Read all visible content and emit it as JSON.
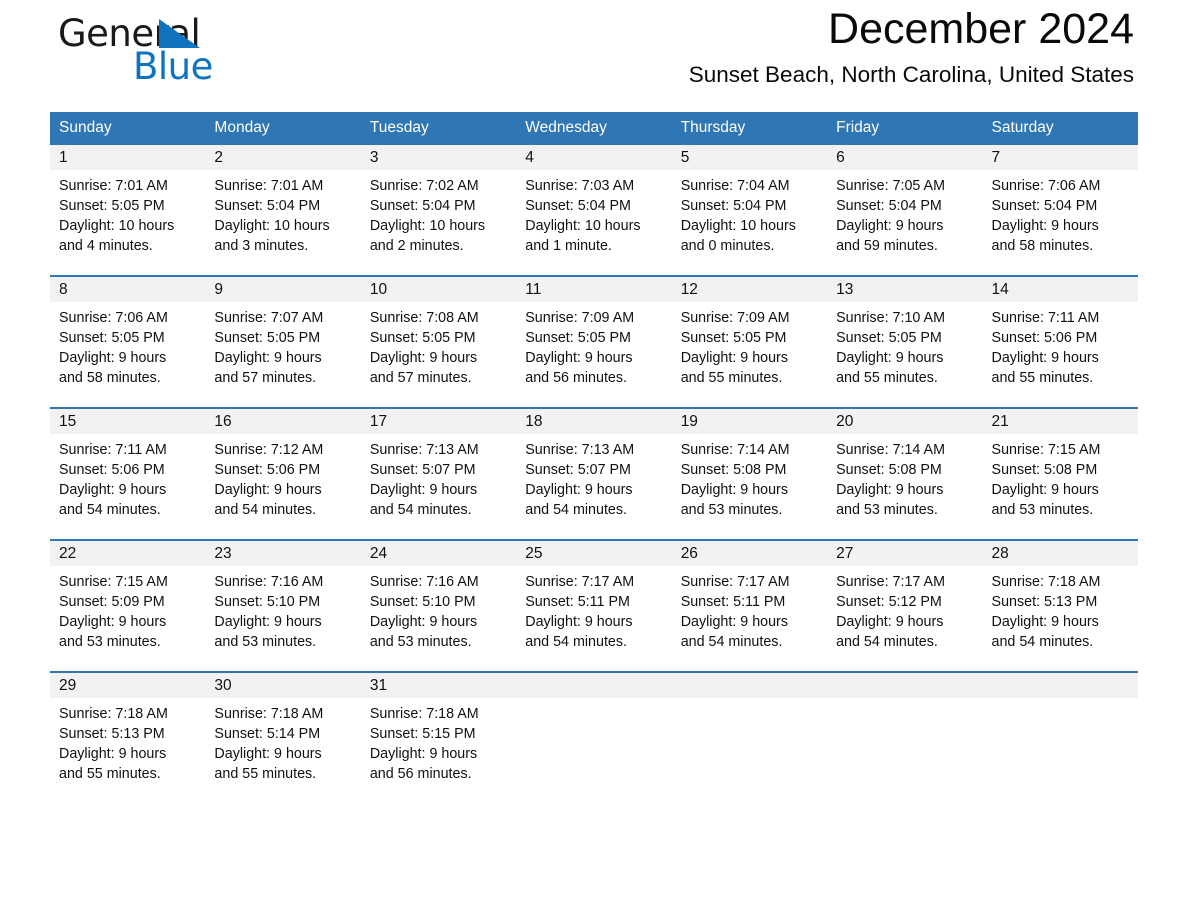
{
  "brand": {
    "name_part1": "General",
    "name_part2": "Blue",
    "triangle_color": "#0f73bd"
  },
  "header": {
    "title": "December 2024",
    "subtitle": "Sunset Beach, North Carolina, United States"
  },
  "colors": {
    "header_blue": "#2f76b4",
    "day_band_gray": "#f2f2f2",
    "text": "#111111"
  },
  "weekdays": [
    "Sunday",
    "Monday",
    "Tuesday",
    "Wednesday",
    "Thursday",
    "Friday",
    "Saturday"
  ],
  "weeks": [
    {
      "days": [
        {
          "num": "1",
          "sunrise": "Sunrise: 7:01 AM",
          "sunset": "Sunset: 5:05 PM",
          "daylight1": "Daylight: 10 hours",
          "daylight2": "and 4 minutes."
        },
        {
          "num": "2",
          "sunrise": "Sunrise: 7:01 AM",
          "sunset": "Sunset: 5:04 PM",
          "daylight1": "Daylight: 10 hours",
          "daylight2": "and 3 minutes."
        },
        {
          "num": "3",
          "sunrise": "Sunrise: 7:02 AM",
          "sunset": "Sunset: 5:04 PM",
          "daylight1": "Daylight: 10 hours",
          "daylight2": "and 2 minutes."
        },
        {
          "num": "4",
          "sunrise": "Sunrise: 7:03 AM",
          "sunset": "Sunset: 5:04 PM",
          "daylight1": "Daylight: 10 hours",
          "daylight2": "and 1 minute."
        },
        {
          "num": "5",
          "sunrise": "Sunrise: 7:04 AM",
          "sunset": "Sunset: 5:04 PM",
          "daylight1": "Daylight: 10 hours",
          "daylight2": "and 0 minutes."
        },
        {
          "num": "6",
          "sunrise": "Sunrise: 7:05 AM",
          "sunset": "Sunset: 5:04 PM",
          "daylight1": "Daylight: 9 hours",
          "daylight2": "and 59 minutes."
        },
        {
          "num": "7",
          "sunrise": "Sunrise: 7:06 AM",
          "sunset": "Sunset: 5:04 PM",
          "daylight1": "Daylight: 9 hours",
          "daylight2": "and 58 minutes."
        }
      ]
    },
    {
      "days": [
        {
          "num": "8",
          "sunrise": "Sunrise: 7:06 AM",
          "sunset": "Sunset: 5:05 PM",
          "daylight1": "Daylight: 9 hours",
          "daylight2": "and 58 minutes."
        },
        {
          "num": "9",
          "sunrise": "Sunrise: 7:07 AM",
          "sunset": "Sunset: 5:05 PM",
          "daylight1": "Daylight: 9 hours",
          "daylight2": "and 57 minutes."
        },
        {
          "num": "10",
          "sunrise": "Sunrise: 7:08 AM",
          "sunset": "Sunset: 5:05 PM",
          "daylight1": "Daylight: 9 hours",
          "daylight2": "and 57 minutes."
        },
        {
          "num": "11",
          "sunrise": "Sunrise: 7:09 AM",
          "sunset": "Sunset: 5:05 PM",
          "daylight1": "Daylight: 9 hours",
          "daylight2": "and 56 minutes."
        },
        {
          "num": "12",
          "sunrise": "Sunrise: 7:09 AM",
          "sunset": "Sunset: 5:05 PM",
          "daylight1": "Daylight: 9 hours",
          "daylight2": "and 55 minutes."
        },
        {
          "num": "13",
          "sunrise": "Sunrise: 7:10 AM",
          "sunset": "Sunset: 5:05 PM",
          "daylight1": "Daylight: 9 hours",
          "daylight2": "and 55 minutes."
        },
        {
          "num": "14",
          "sunrise": "Sunrise: 7:11 AM",
          "sunset": "Sunset: 5:06 PM",
          "daylight1": "Daylight: 9 hours",
          "daylight2": "and 55 minutes."
        }
      ]
    },
    {
      "days": [
        {
          "num": "15",
          "sunrise": "Sunrise: 7:11 AM",
          "sunset": "Sunset: 5:06 PM",
          "daylight1": "Daylight: 9 hours",
          "daylight2": "and 54 minutes."
        },
        {
          "num": "16",
          "sunrise": "Sunrise: 7:12 AM",
          "sunset": "Sunset: 5:06 PM",
          "daylight1": "Daylight: 9 hours",
          "daylight2": "and 54 minutes."
        },
        {
          "num": "17",
          "sunrise": "Sunrise: 7:13 AM",
          "sunset": "Sunset: 5:07 PM",
          "daylight1": "Daylight: 9 hours",
          "daylight2": "and 54 minutes."
        },
        {
          "num": "18",
          "sunrise": "Sunrise: 7:13 AM",
          "sunset": "Sunset: 5:07 PM",
          "daylight1": "Daylight: 9 hours",
          "daylight2": "and 54 minutes."
        },
        {
          "num": "19",
          "sunrise": "Sunrise: 7:14 AM",
          "sunset": "Sunset: 5:08 PM",
          "daylight1": "Daylight: 9 hours",
          "daylight2": "and 53 minutes."
        },
        {
          "num": "20",
          "sunrise": "Sunrise: 7:14 AM",
          "sunset": "Sunset: 5:08 PM",
          "daylight1": "Daylight: 9 hours",
          "daylight2": "and 53 minutes."
        },
        {
          "num": "21",
          "sunrise": "Sunrise: 7:15 AM",
          "sunset": "Sunset: 5:08 PM",
          "daylight1": "Daylight: 9 hours",
          "daylight2": "and 53 minutes."
        }
      ]
    },
    {
      "days": [
        {
          "num": "22",
          "sunrise": "Sunrise: 7:15 AM",
          "sunset": "Sunset: 5:09 PM",
          "daylight1": "Daylight: 9 hours",
          "daylight2": "and 53 minutes."
        },
        {
          "num": "23",
          "sunrise": "Sunrise: 7:16 AM",
          "sunset": "Sunset: 5:10 PM",
          "daylight1": "Daylight: 9 hours",
          "daylight2": "and 53 minutes."
        },
        {
          "num": "24",
          "sunrise": "Sunrise: 7:16 AM",
          "sunset": "Sunset: 5:10 PM",
          "daylight1": "Daylight: 9 hours",
          "daylight2": "and 53 minutes."
        },
        {
          "num": "25",
          "sunrise": "Sunrise: 7:17 AM",
          "sunset": "Sunset: 5:11 PM",
          "daylight1": "Daylight: 9 hours",
          "daylight2": "and 54 minutes."
        },
        {
          "num": "26",
          "sunrise": "Sunrise: 7:17 AM",
          "sunset": "Sunset: 5:11 PM",
          "daylight1": "Daylight: 9 hours",
          "daylight2": "and 54 minutes."
        },
        {
          "num": "27",
          "sunrise": "Sunrise: 7:17 AM",
          "sunset": "Sunset: 5:12 PM",
          "daylight1": "Daylight: 9 hours",
          "daylight2": "and 54 minutes."
        },
        {
          "num": "28",
          "sunrise": "Sunrise: 7:18 AM",
          "sunset": "Sunset: 5:13 PM",
          "daylight1": "Daylight: 9 hours",
          "daylight2": "and 54 minutes."
        }
      ]
    },
    {
      "days": [
        {
          "num": "29",
          "sunrise": "Sunrise: 7:18 AM",
          "sunset": "Sunset: 5:13 PM",
          "daylight1": "Daylight: 9 hours",
          "daylight2": "and 55 minutes."
        },
        {
          "num": "30",
          "sunrise": "Sunrise: 7:18 AM",
          "sunset": "Sunset: 5:14 PM",
          "daylight1": "Daylight: 9 hours",
          "daylight2": "and 55 minutes."
        },
        {
          "num": "31",
          "sunrise": "Sunrise: 7:18 AM",
          "sunset": "Sunset: 5:15 PM",
          "daylight1": "Daylight: 9 hours",
          "daylight2": "and 56 minutes."
        },
        {
          "num": "",
          "sunrise": "",
          "sunset": "",
          "daylight1": "",
          "daylight2": ""
        },
        {
          "num": "",
          "sunrise": "",
          "sunset": "",
          "daylight1": "",
          "daylight2": ""
        },
        {
          "num": "",
          "sunrise": "",
          "sunset": "",
          "daylight1": "",
          "daylight2": ""
        },
        {
          "num": "",
          "sunrise": "",
          "sunset": "",
          "daylight1": "",
          "daylight2": ""
        }
      ]
    }
  ]
}
